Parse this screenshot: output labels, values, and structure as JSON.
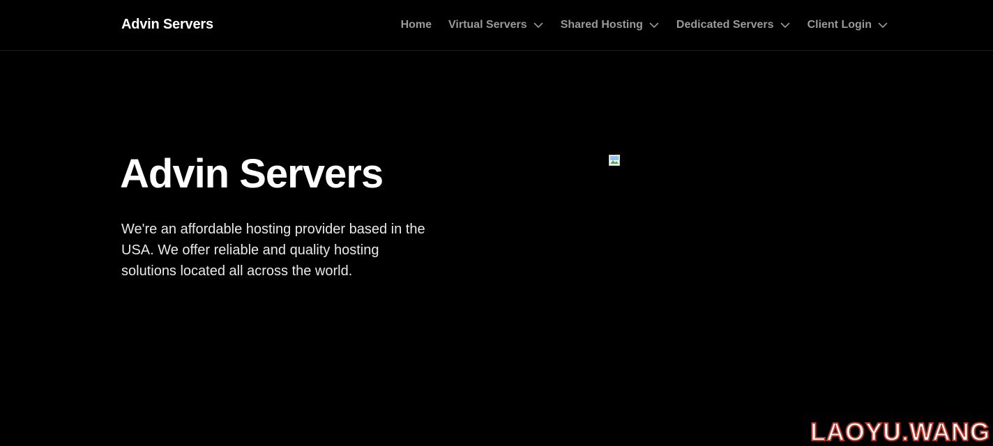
{
  "header": {
    "brand": "Advin Servers",
    "nav": [
      {
        "label": "Home",
        "dropdown": false,
        "icon": null
      },
      {
        "label": "Virtual Servers",
        "dropdown": true,
        "icon": "chevron-down-icon"
      },
      {
        "label": "Shared Hosting",
        "dropdown": true,
        "icon": "chevron-down-icon"
      },
      {
        "label": "Dedicated Servers",
        "dropdown": true,
        "icon": "chevron-down-icon"
      },
      {
        "label": "Client Login",
        "dropdown": true,
        "icon": "chevron-down-icon"
      }
    ]
  },
  "hero": {
    "title": "Advin Servers",
    "description": "We're an affordable hosting provider based in the USA. We offer reliable and quality hosting solutions located all across the world.",
    "image_icon": "broken-image-icon"
  },
  "watermark": {
    "text": "LAOYU.WANG"
  },
  "colors": {
    "background": "#000000",
    "text_primary": "#ffffff",
    "nav_text": "#9a9a9a",
    "watermark_stroke": "#c0392b"
  }
}
